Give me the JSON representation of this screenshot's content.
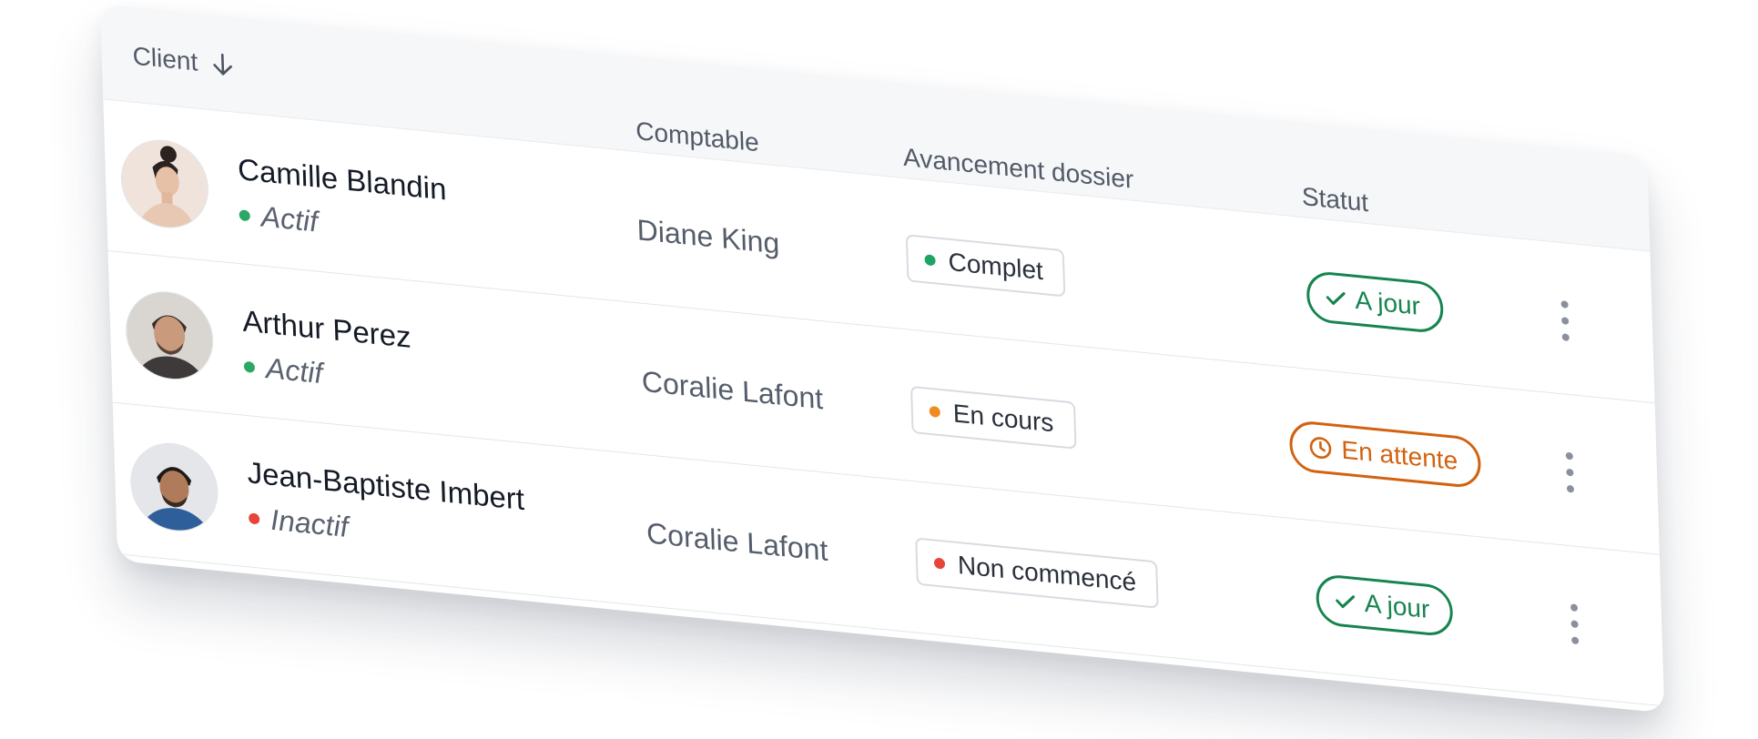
{
  "table": {
    "headers": {
      "client": "Client",
      "comptable": "Comptable",
      "avancement": "Avancement dossier",
      "statut": "Statut"
    },
    "sort_icon": "arrow-down-icon",
    "row_menu_icon": "vertical-ellipsis-icon",
    "rows": [
      {
        "name": "Camille Blandin",
        "client_status": "Actif",
        "client_status_color": "#2aa866",
        "comptable": "Diane King",
        "avancement": "Complet",
        "avancement_color": "#1fa464",
        "statut": "A jour",
        "statut_icon": "check-icon",
        "statut_color": "#16844f"
      },
      {
        "name": "Arthur Perez",
        "client_status": "Actif",
        "client_status_color": "#2aa866",
        "comptable": "Coralie Lafont",
        "avancement": "En cours",
        "avancement_color": "#f28a24",
        "statut": "En attente",
        "statut_icon": "clock-icon",
        "statut_color": "#d2620f"
      },
      {
        "name": "Jean-Baptiste Imbert",
        "client_status": "Inactif",
        "client_status_color": "#e8453a",
        "comptable": "Coralie Lafont",
        "avancement": "Non commencé",
        "avancement_color": "#e8453a",
        "statut": "A jour",
        "statut_icon": "check-icon",
        "statut_color": "#16844f"
      }
    ]
  }
}
